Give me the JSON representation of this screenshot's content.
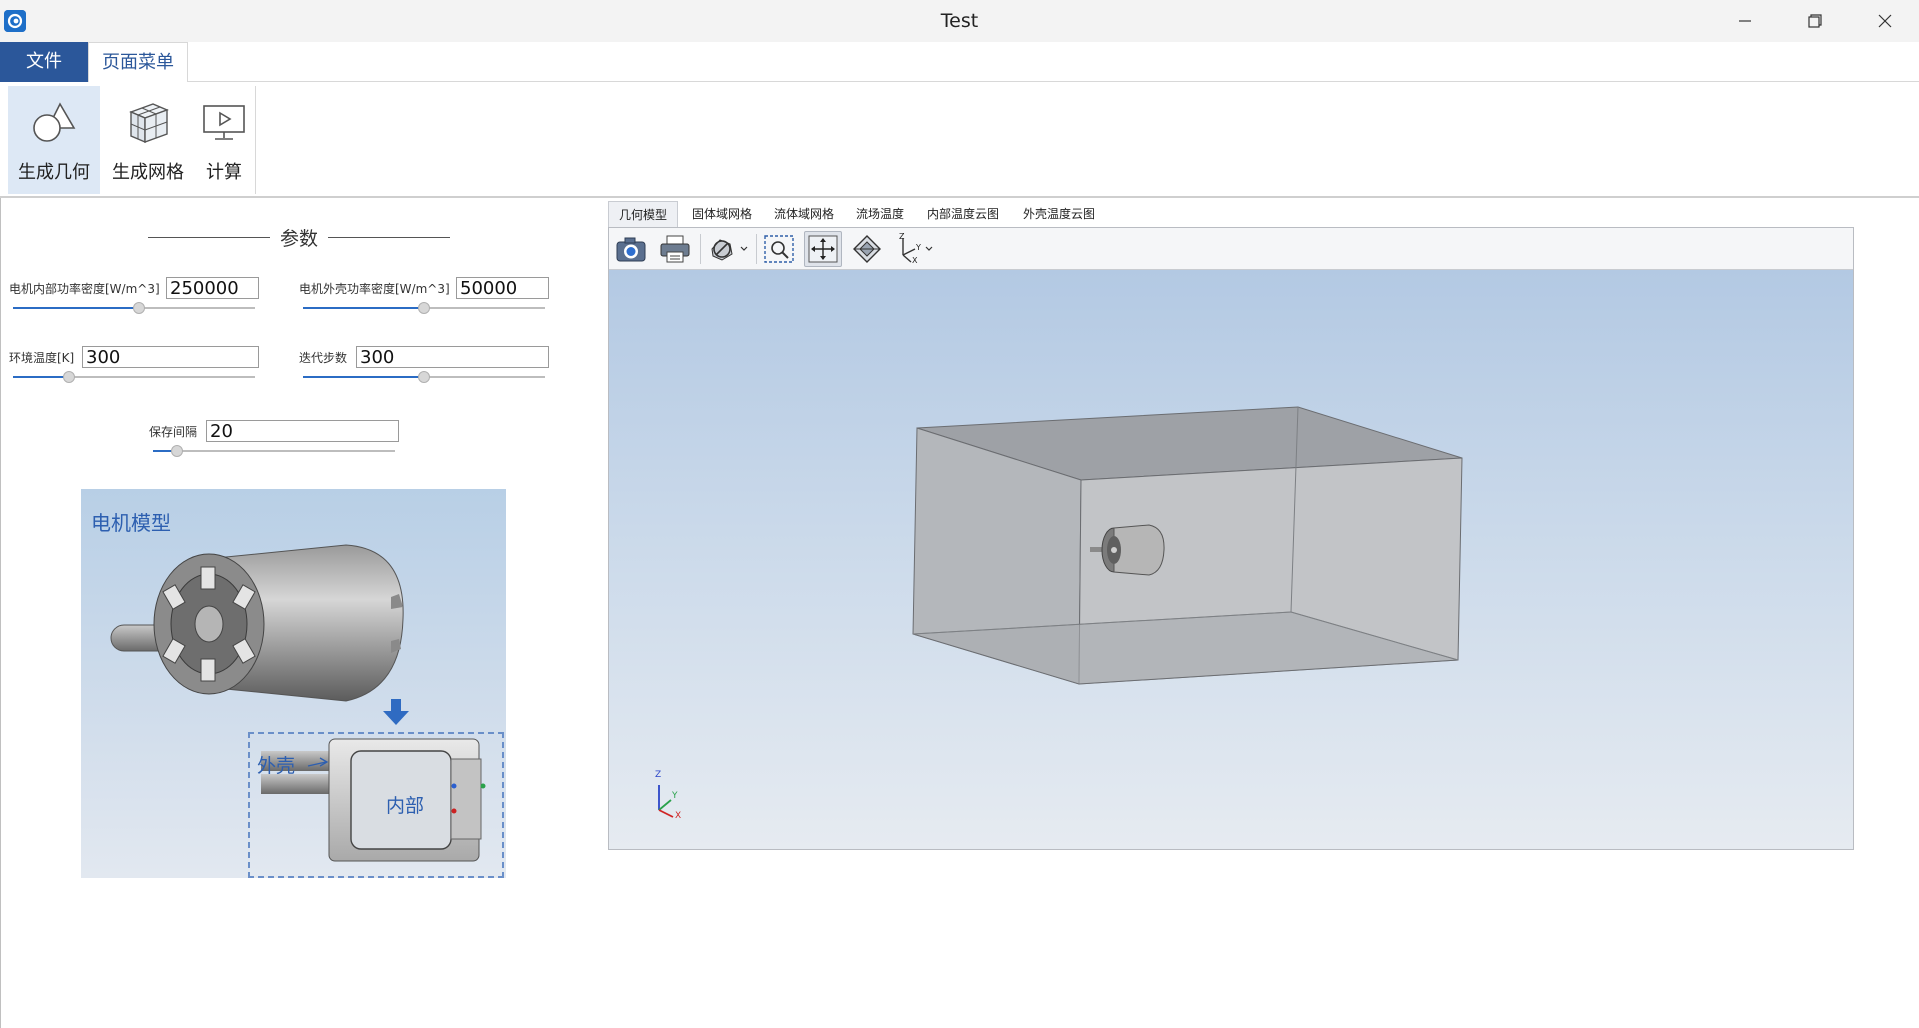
{
  "window": {
    "title": "Test"
  },
  "ribbon": {
    "tabs": [
      "文件",
      "页面菜单"
    ],
    "buttons": [
      "生成几何",
      "生成网格",
      "计算"
    ]
  },
  "params": {
    "title": "参数",
    "inner_power": {
      "label": "电机内部功率密度[W/m^3]",
      "value": "250000",
      "slider": 0.52
    },
    "shell_power": {
      "label": "电机外壳功率密度[W/m^3]",
      "value": "50000",
      "slider": 0.5
    },
    "ambient_temp": {
      "label": "环境温度[K]",
      "value": "300",
      "slider": 0.23
    },
    "iterations": {
      "label": "迭代步数",
      "value": "300",
      "slider": 0.5
    },
    "save_interval": {
      "label": "保存间隔",
      "value": "20",
      "slider": 0.1
    }
  },
  "motor": {
    "title": "电机模型",
    "shell_label": "外壳",
    "inner_label": "内部"
  },
  "viewer": {
    "tabs": [
      "几何模型",
      "固体域网格",
      "流体域网格",
      "流场温度",
      "内部温度云图",
      "外壳温度云图"
    ],
    "active_tab": 0,
    "toolbar": [
      "camera-icon",
      "print-icon",
      "display-mode-icon",
      "zoom-window-icon",
      "pan-icon",
      "fit-all-icon",
      "axis-view-icon"
    ],
    "triad": {
      "x": "X",
      "y": "Y",
      "z": "Z"
    }
  },
  "colors": {
    "accent": "#2b579a",
    "ribbon_selected": "#dde8f5",
    "slider_fill": "#2b6cc4"
  }
}
